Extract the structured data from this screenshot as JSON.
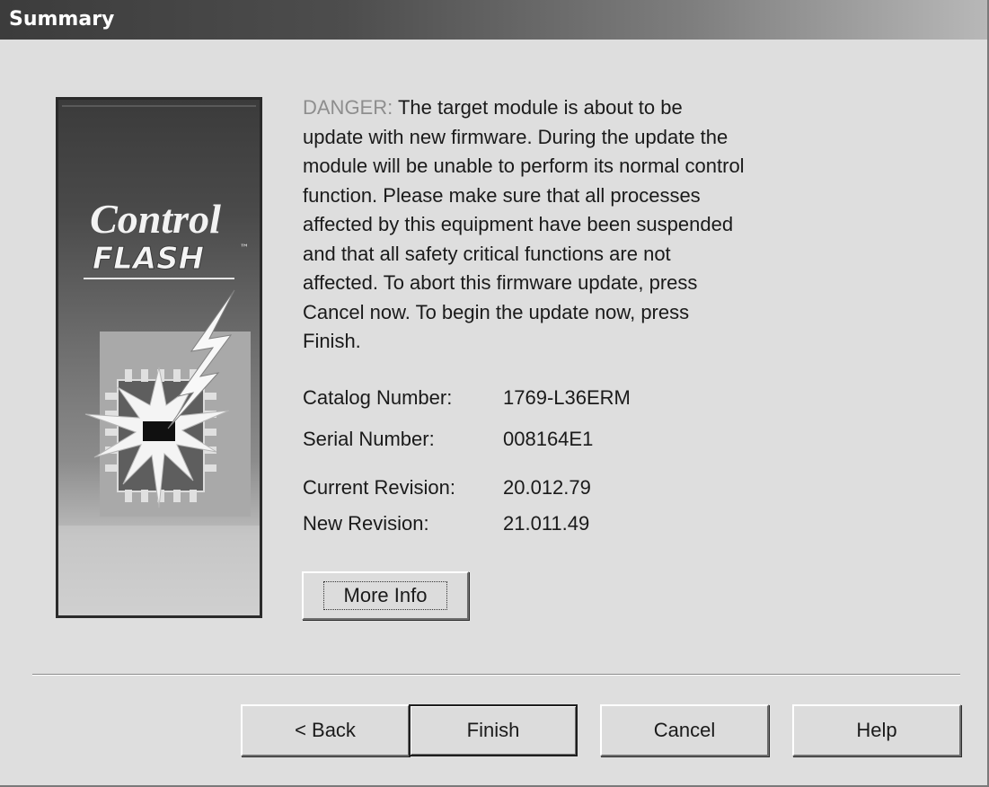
{
  "window": {
    "title": "Summary"
  },
  "logo": {
    "line1": "Control",
    "line2": "FLASH",
    "trademark": "™"
  },
  "message": {
    "danger_label": "DANGER:",
    "lines": [
      " The target module is about to be",
      "update with new firmware. During the update the",
      "module will be unable to perform its normal control",
      "function. Please make sure that all processes",
      "affected by this equipment have been suspended",
      "and that all safety critical functions are not",
      "affected. To abort this firmware update, press",
      "Cancel now. To begin the update now, press",
      "Finish."
    ]
  },
  "details": {
    "catalog_label": "Catalog Number:",
    "catalog_value": "1769-L36ERM",
    "serial_label": "Serial Number:",
    "serial_value": "008164E1",
    "current_label": "Current Revision:",
    "current_value": "20.012.79",
    "new_label": "New Revision:",
    "new_value": "21.011.49"
  },
  "buttons": {
    "more_info": "More Info",
    "back": "< Back",
    "finish": "Finish",
    "cancel": "Cancel",
    "help": "Help"
  }
}
